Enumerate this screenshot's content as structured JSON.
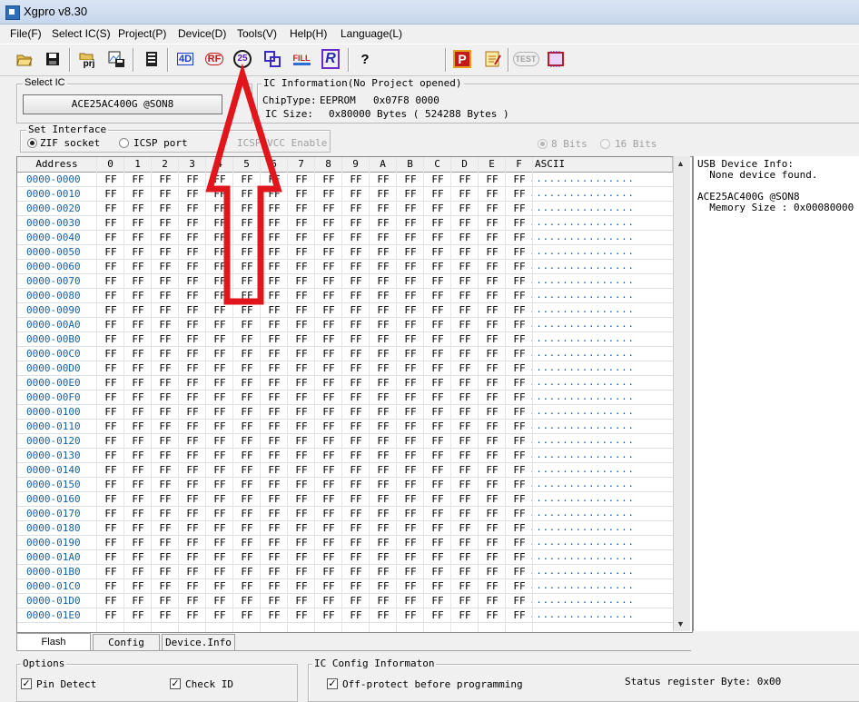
{
  "window": {
    "title": "Xgpro v8.30"
  },
  "menu": [
    "File(F)",
    "Select IC(S)",
    "Project(P)",
    "Device(D)",
    "Tools(V)",
    "Help(H)",
    "Language(L)"
  ],
  "toolbar": {
    "icons": [
      "open-icon",
      "save-icon",
      "project-icon",
      "save-project-icon",
      "read-icon",
      "verify-icon",
      "blank-check-icon",
      "program-25-icon",
      "erase-icon",
      "fill-icon",
      "read-id-icon",
      "help-icon",
      "production-icon",
      "edit-icon",
      "test-icon",
      "chip-test-icon"
    ],
    "labels": {
      "prj": "prj",
      "fill": "FILL",
      "r": "R",
      "help": "?",
      "p": "P",
      "test": "TEST",
      "read": "4D",
      "verify": "RF",
      "program25": "25"
    }
  },
  "select_ic": {
    "legend": "Select IC",
    "value": "ACE25AC400G @SON8"
  },
  "ic_info": {
    "legend": "IC Information(No Project opened)",
    "chip_type_label": "ChipType:",
    "chip_type": "EEPROM",
    "checksum": "0x07F8 0000",
    "ic_size_label": "IC Size:",
    "ic_size": "0x80000 Bytes ( 524288 Bytes )"
  },
  "interface": {
    "legend": "Set Interface",
    "zif": "ZIF socket",
    "icsp": "ICSP port",
    "icsp_vcc": "ICSP_VCC Enable",
    "bits8": "8 Bits",
    "bits16": "16 Bits"
  },
  "grid": {
    "headers": [
      "Address",
      "0",
      "1",
      "2",
      "3",
      "4",
      "5",
      "6",
      "7",
      "8",
      "9",
      "A",
      "B",
      "C",
      "D",
      "E",
      "F",
      "ASCII"
    ],
    "rows": [
      "0000-0000",
      "0000-0010",
      "0000-0020",
      "0000-0030",
      "0000-0040",
      "0000-0050",
      "0000-0060",
      "0000-0070",
      "0000-0080",
      "0000-0090",
      "0000-00A0",
      "0000-00B0",
      "0000-00C0",
      "0000-00D0",
      "0000-00E0",
      "0000-00F0",
      "0000-0100",
      "0000-0110",
      "0000-0120",
      "0000-0130",
      "0000-0140",
      "0000-0150",
      "0000-0160",
      "0000-0170",
      "0000-0180",
      "0000-0190",
      "0000-01A0",
      "0000-01B0",
      "0000-01C0",
      "0000-01D0",
      "0000-01E0"
    ],
    "byte": "FF",
    "ascii": "................"
  },
  "device_info": {
    "line1": "USB Device Info:",
    "line2": "  None device found.",
    "line3": "ACE25AC400G @SON8",
    "line4": "  Memory Size : 0x00080000"
  },
  "tabs": [
    "Flash",
    "Config",
    "Device.Info"
  ],
  "options": {
    "legend": "Options",
    "pin_detect": "Pin Detect",
    "check_id": "Check ID"
  },
  "ic_config": {
    "legend": "IC Config Informaton",
    "off_protect": "Off-protect before programming",
    "status_register": "Status register Byte: 0x00"
  },
  "colors": {
    "address": "#1560a8",
    "arrow": "#e0161c"
  }
}
